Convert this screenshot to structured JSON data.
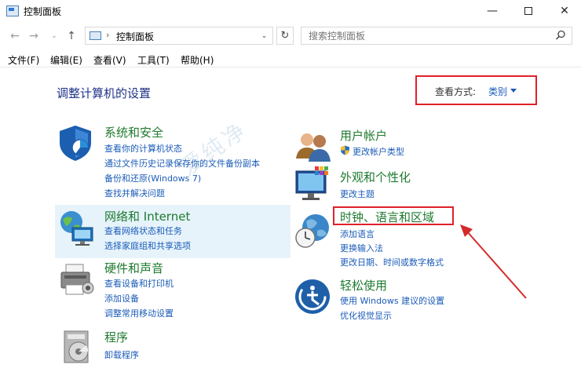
{
  "window": {
    "title": "控制面板"
  },
  "address": {
    "path": "控制面板",
    "search_placeholder": "搜索控制面板"
  },
  "menu": [
    "文件(F)",
    "编辑(E)",
    "查看(V)",
    "工具(T)",
    "帮助(H)"
  ],
  "main": {
    "title": "调整计算机的设置",
    "view_by_label": "查看方式:",
    "view_by_value": "类别"
  },
  "categories": {
    "security": {
      "title": "系统和安全",
      "links": [
        "查看你的计算机状态",
        "通过文件历史记录保存你的文件备份副本",
        "备份和还原(Windows 7)",
        "查找并解决问题"
      ]
    },
    "network": {
      "title": "网络和 Internet",
      "links": [
        "查看网络状态和任务",
        "选择家庭组和共享选项"
      ]
    },
    "hardware": {
      "title": "硬件和声音",
      "links": [
        "查看设备和打印机",
        "添加设备",
        "调整常用移动设置"
      ]
    },
    "programs": {
      "title": "程序",
      "links": [
        "卸载程序"
      ]
    },
    "accounts": {
      "title": "用户帐户",
      "links": [
        "更改帐户类型"
      ]
    },
    "appearance": {
      "title": "外观和个性化",
      "links": [
        "更改主题"
      ]
    },
    "clock": {
      "title": "时钟、语言和区域",
      "links": [
        "添加语言",
        "更换输入法",
        "更改日期、时间或数字格式"
      ]
    },
    "ease": {
      "title": "轻松使用",
      "links": [
        "使用 Windows 建议的设置",
        "优化视觉显示"
      ]
    }
  },
  "colors": {
    "category_title": "#1e7a2e",
    "link": "#1a5bb8",
    "highlight_box": "#e0202a",
    "hover_bg": "#e6f3fb"
  }
}
